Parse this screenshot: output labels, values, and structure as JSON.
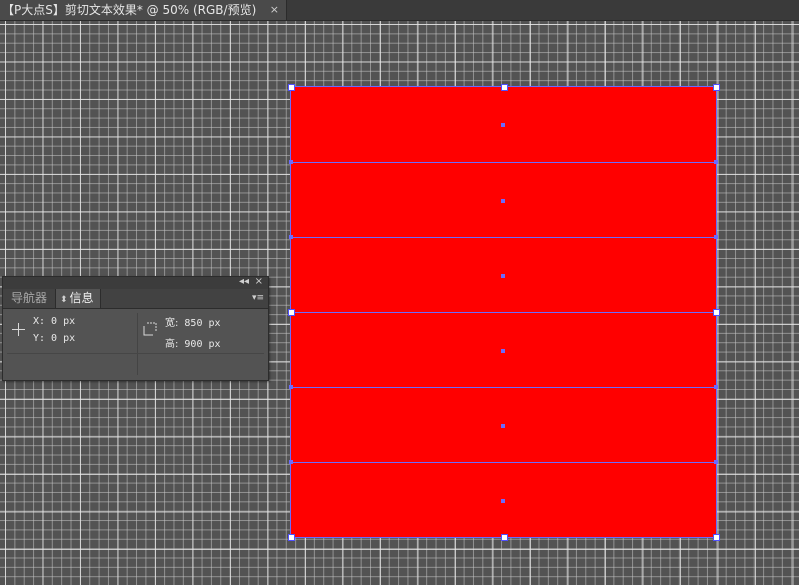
{
  "document_tab": {
    "title": "【P大点S】剪切文本效果* @ 50% (RGB/预览)",
    "close_glyph": "×"
  },
  "canvas": {
    "background_color": "#535353",
    "grid_color": "#c8c8c8",
    "artboard_color": "#ff0000",
    "guide_color": "#6b6bff",
    "strip_count": 6
  },
  "info_panel": {
    "collapse_glyph": "◂◂",
    "close_glyph": "×",
    "tabs": [
      {
        "label": "导航器"
      },
      {
        "label": "信息"
      }
    ],
    "menu_glyph": "▾≡",
    "x_readout": "X: 0 px",
    "y_readout": "Y: 0 px",
    "width_label": "宽:",
    "width_value": "850 px",
    "height_label": "高:",
    "height_value": "900 px"
  }
}
